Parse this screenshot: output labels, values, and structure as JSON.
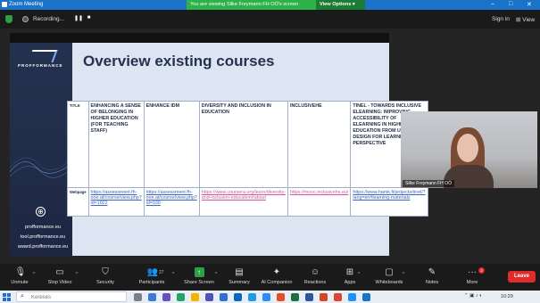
{
  "window": {
    "title": "Zoom Meeting",
    "minimize": "–",
    "maximize": "□",
    "close": "✕"
  },
  "banner": {
    "text": "You are viewing Silke Freymann FH OÖ's screen",
    "view_options": "View Options ▾"
  },
  "topbar": {
    "recording_label": "Recording...",
    "pause": "❚❚",
    "stop": "■",
    "sign_in": "Sign in",
    "view": "⊞ View"
  },
  "slide": {
    "title": "Overview existing courses",
    "logo_text": "PROFFORMANCE",
    "links": [
      "profformance.eu",
      "tool.profformance.eu",
      "award.profformance.eu"
    ],
    "table": {
      "row_labels": [
        "TITLE",
        "Webpage"
      ],
      "courses": [
        {
          "title": "ENHANCING A SENSE OF BELONGING IN HIGHER EDUCATION (FOR TEACHING STAFF)",
          "url": "https://assessment.fh-ooe.at/course/view.php?id=1022"
        },
        {
          "title": "ENHANCE IDM",
          "url": "https://assessment.fh-ooe.at/course/view.php?id=930"
        },
        {
          "title": "DIVERSITY AND INCLUSION IN EDUCATION",
          "url": "https://www.coursera.org/learn/diversity-and-inclusion-education#about"
        },
        {
          "title": "INCLUSIVEHE",
          "url": "https://mooc.inclusivehe.eu/"
        },
        {
          "title": "TINEL - TOWARDS INCLUSIVE ELEARNING: IMPROVING ACCESSIBILITY OF ELEARNING IN HIGHER EDUCATION FROM UNIVERSAL DESIGN FOR LEARNING PERSPECTIVE",
          "url": "https://www.hamk.fi/projects/tinel/?lang=en#learning-materials"
        }
      ]
    }
  },
  "video": {
    "participant_name": "Silke Freymann FH OÖ"
  },
  "controls": {
    "unmute": "Unmute",
    "stop_video": "Stop Video",
    "security": "Security",
    "participants": "Participants",
    "participants_count": "27",
    "share_screen": "Share Screen",
    "summary": "Summary",
    "ai_companion": "AI Companion",
    "reactions": "Reactions",
    "apps": "Apps",
    "whiteboards": "Whiteboards",
    "notes": "Notes",
    "more": "More",
    "more_badge": "2",
    "leave": "Leave"
  },
  "taskbar": {
    "search_placeholder": "Keresés",
    "clock": "10:29"
  },
  "colors": {
    "zoom_blue": "#1b73c9",
    "share_green": "#2db24a",
    "leave_red": "#e02b2b",
    "slide_navy": "#24314f"
  }
}
